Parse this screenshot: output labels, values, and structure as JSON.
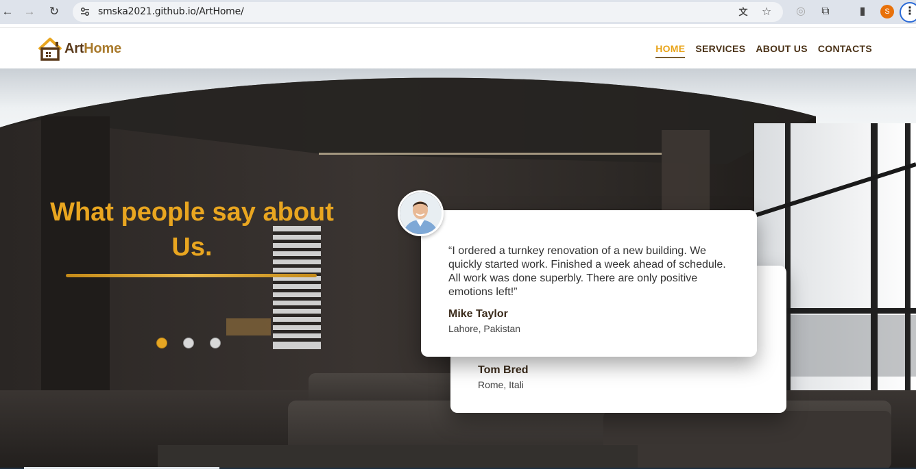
{
  "browser": {
    "url": "smska2021.github.io/ArtHome/",
    "profile_initial": "S",
    "icons": [
      "back-arrow-icon",
      "forward-arrow-icon",
      "reload-icon",
      "site-settings-icon",
      "translate-icon",
      "star-icon",
      "extension-icon",
      "puzzle-icon",
      "side-panel-icon",
      "kebab-menu-icon"
    ]
  },
  "site": {
    "logo": {
      "part1": "Art",
      "part2": "Home"
    },
    "nav": [
      {
        "label": "HOME",
        "active": true
      },
      {
        "label": "SERVICES",
        "active": false
      },
      {
        "label": "ABOUT US",
        "active": false
      },
      {
        "label": "CONTACTS",
        "active": false
      }
    ]
  },
  "hero": {
    "title_line1": "What people say about",
    "title_line2": "Us.",
    "slider": {
      "count": 3,
      "active_index": 0
    }
  },
  "testimonials": [
    {
      "quote": "“I ordered a turnkey renovation of a new building. We quickly started work. Finished a week ahead of schedule. All work was done superbly. There are only positive emotions left!”",
      "name": "Mike Taylor",
      "location": "Lahore, Pakistan"
    },
    {
      "name": "Tom Bred",
      "location": "Rome, Itali"
    }
  ],
  "colors": {
    "accent": "#e9a620",
    "brand_dark": "#4a3116",
    "chrome": "#dee3eb"
  }
}
